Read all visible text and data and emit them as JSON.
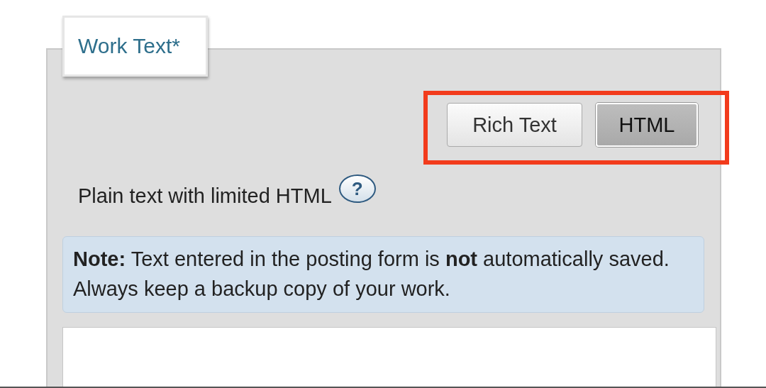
{
  "panel": {
    "legend": "Work Text*"
  },
  "mode_switch": {
    "highlighted": true,
    "buttons": [
      {
        "label": "Rich Text",
        "selected": false
      },
      {
        "label": "HTML",
        "selected": true
      }
    ]
  },
  "format_hint": {
    "text": "Plain text with limited HTML",
    "help": "?"
  },
  "note": "**Note:** Text entered in the posting form is **not** automatically saved. Always keep a backup copy of your work.",
  "work_text_field": {
    "kind": "textarea"
  }
}
